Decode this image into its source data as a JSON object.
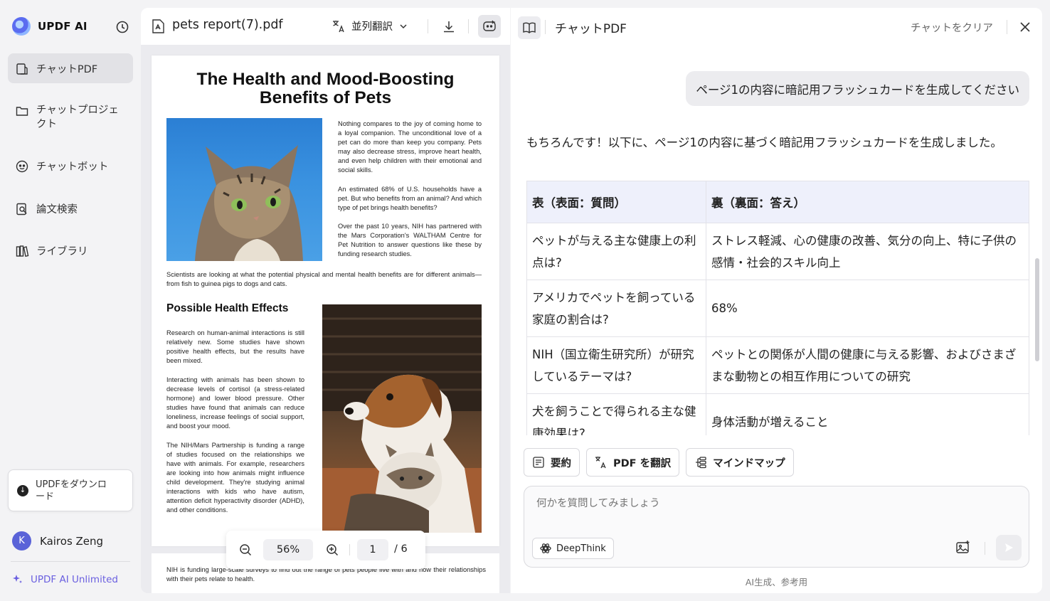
{
  "sidebar": {
    "brand": "UPDF AI",
    "items": [
      {
        "label": "チャットPDF"
      },
      {
        "label": "チャットプロジェクト"
      },
      {
        "label": "チャットボット"
      },
      {
        "label": "論文検索"
      },
      {
        "label": "ライブラリ"
      }
    ],
    "download_label": "UPDFをダウンロード",
    "user": {
      "initial": "K",
      "name": "Kairos Zeng"
    },
    "plan_label": "UPDF AI Unlimited"
  },
  "pdf": {
    "file_name": "pets report(7).pdf",
    "translate_label": "並列翻訳",
    "doc_title": "The Health and Mood-Boosting Benefits of Pets",
    "para1": "Nothing compares to the joy of coming home to a loyal companion. The unconditional love of a pet can do more than keep you company. Pets may also decrease stress, improve heart health, and even help children with their emotional and social skills.",
    "para2": "An estimated 68% of U.S. households have a pet. But who benefits from an animal? And which type of pet brings health benefits?",
    "para3": "Over the past 10 years, NIH has partnered with the Mars Corporation's WALTHAM Centre for Pet Nutrition to answer questions like these by funding research studies.",
    "para4": "Scientists are looking at what the potential physical and mental health benefits are for different animals—from fish to guinea pigs to dogs and cats.",
    "subhead": "Possible Health Effects",
    "para5": "Research on human-animal interactions is still relatively new. Some studies have shown positive health effects, but the results have been mixed.",
    "para6": "Interacting with animals has been shown to decrease levels of cortisol (a stress-related hormone) and lower blood pressure. Other studies have found that animals can reduce loneliness, increase feelings of social support, and boost your mood.",
    "para7": "The NIH/Mars Partnership is funding a range of studies focused on the relationships we have with animals. For example, researchers are looking into how animals might influence child development. They're studying animal interactions with kids who have autism, attention deficit hyperactivity disorder (ADHD), and other conditions.",
    "page2_text": "NIH is funding large-scale surveys to find out the range of pets people live with and how their relationships with their pets relate to health.",
    "zoom": "56%",
    "current_page": "1",
    "total_pages": "/ 6"
  },
  "chat": {
    "title": "チャットPDF",
    "clear_label": "チャットをクリア",
    "user_message": "ページ1の内容に暗記用フラッシュカードを生成してください",
    "ai_intro": "もちろんです！以下に、ページ1の内容に基づく暗記用フラッシュカードを生成しました。",
    "table": {
      "headers": [
        "表（表面：質問）",
        "裏（裏面：答え）"
      ],
      "rows": [
        [
          "ペットが与える主な健康上の利点は?",
          "ストレス軽減、心の健康の改善、気分の向上、特に子供の感情・社会的スキル向上"
        ],
        [
          "アメリカでペットを飼っている家庭の割合は?",
          "68%"
        ],
        [
          "NIH（国立衛生研究所）が研究しているテーマは?",
          "ペットとの関係が人間の健康に与える影響、およびさまざまな動物との相互作用についての研究"
        ],
        [
          "犬を飼うことで得られる主な健康効果は?",
          "身体活動が増えること"
        ]
      ]
    },
    "quick_actions": [
      "要約",
      "PDF を翻訳",
      "マインドマップ"
    ],
    "input_placeholder": "何かを質問してみましょう",
    "deepthink_label": "DeepThink",
    "disclaimer": "AI生成、参考用"
  }
}
